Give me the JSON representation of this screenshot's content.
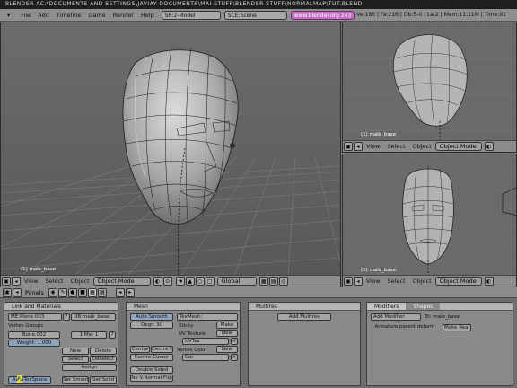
{
  "title_bar": "BLENDER AC:\\DOCUMENTS AND SETTINGS\\JAVIAY DOCUMENTS\\MAI STUFF\\BLENDER STUFF\\NORMALMAP\\TUT.BLEND",
  "menu": [
    "File",
    "Add",
    "Timeline",
    "Game",
    "Render",
    "Help"
  ],
  "screen_field": "SR:2-Model",
  "scene_field": "SCE:Scene",
  "url_field": "www.blender.org 243",
  "stats": "Ve:185 | Fa:216 | Ob:5-0 | La:2 | Mem:11.11M | Time:01",
  "viewport_main": {
    "object_label": "(1) male_base",
    "menu": [
      "View",
      "Select",
      "Object"
    ],
    "mode": "Object Mode",
    "orientation": "Global"
  },
  "viewport_side": {
    "object_label": "(1) male_base",
    "menu": [
      "View",
      "Select",
      "Object"
    ],
    "mode": "Object Mode"
  },
  "viewport_front": {
    "object_label": "(1) male_base",
    "menu": [
      "View",
      "Select",
      "Object"
    ],
    "mode": "Object Mode"
  },
  "buttons_header": {
    "panels_label": "Panels"
  },
  "link_materials": {
    "title": "Link and Materials",
    "me_field": "ME:Plane.003",
    "f_label": "F",
    "ob_field": "OB:male_base",
    "vertex_groups": "Vertex Groups",
    "group_name": "Bone.002",
    "weight": "Weight: 1.000",
    "mat": "1 Mat 1",
    "new": "New",
    "delete": "Delete",
    "select": "Select",
    "deselect": "Deselect",
    "assign": "Assign",
    "set_smooth": "Set Smooth",
    "set_solid": "Set Solid",
    "autotexspace": "AutoTexSpace"
  },
  "mesh": {
    "title": "Mesh",
    "auto_smooth": "Auto Smooth",
    "degr": "Degr: 30",
    "texmesh": "TexMesh:",
    "sticky": "Sticky",
    "make": "Make",
    "uv_texture": "UV Texture",
    "new": "New",
    "uvtex": "UVTex",
    "vertex_color": "Vertex Color",
    "vc_new": "New",
    "col": "Col",
    "centre": "Centre",
    "centre_new": "Centre New",
    "centre_cursor": "Centre Cursor",
    "double_sided": "Double Sided",
    "no_vnormal_flip": "No V.Normal Flip"
  },
  "multires": {
    "title": "Multires",
    "add_multires": "Add Multires"
  },
  "modifiers": {
    "tab_modifiers": "Modifiers",
    "tab_shapes": "Shapes",
    "add_modifier": "Add Modifier",
    "to": "To: male_base",
    "armature_parent_deform": "Armature parent deform",
    "make_real": "Make Real"
  },
  "corner_number": "2",
  "colors": {
    "title_bg": "#1e1e1e",
    "viewport_bg": "#5f5f5f",
    "url_field": "#c46ec4",
    "panel_header": "#b4b4b4"
  }
}
